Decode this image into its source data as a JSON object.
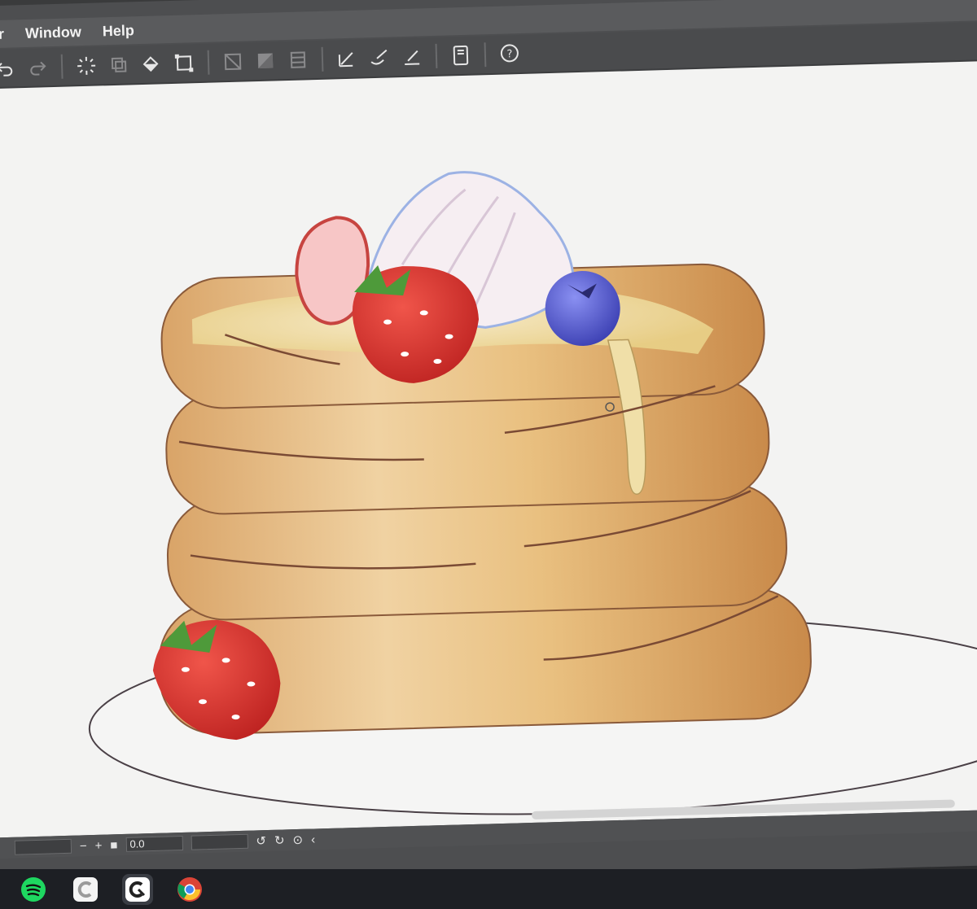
{
  "menu": {
    "items": [
      {
        "label": "ter"
      },
      {
        "label": "Window"
      },
      {
        "label": "Help"
      }
    ]
  },
  "toolbar": {
    "tools": [
      "undo-icon",
      "redo-icon",
      "loading-icon",
      "copy-icon",
      "fill-icon",
      "transform-icon",
      "layer-clip-icon",
      "layer-mask-icon",
      "layer-stack-icon",
      "pen-icon",
      "brush-icon",
      "ruler-pen-icon",
      "tablet-icon",
      "help-bubble-icon"
    ]
  },
  "status": {
    "zoom_value": "0.0",
    "minus_label": "−",
    "plus_label": "+",
    "square_label": "■"
  },
  "taskbar": {
    "apps": [
      "spotify-icon",
      "clipstudio-icon",
      "clipstudio-paint-icon",
      "chrome-icon"
    ]
  },
  "colors": {
    "accent_menu": "#5a5b5d",
    "canvas": "#f3f3f2",
    "pancake": "#e7c08a",
    "strawberry": "#d8342c",
    "blueberry": "#4a52c8",
    "cream": "#f6eef2"
  }
}
